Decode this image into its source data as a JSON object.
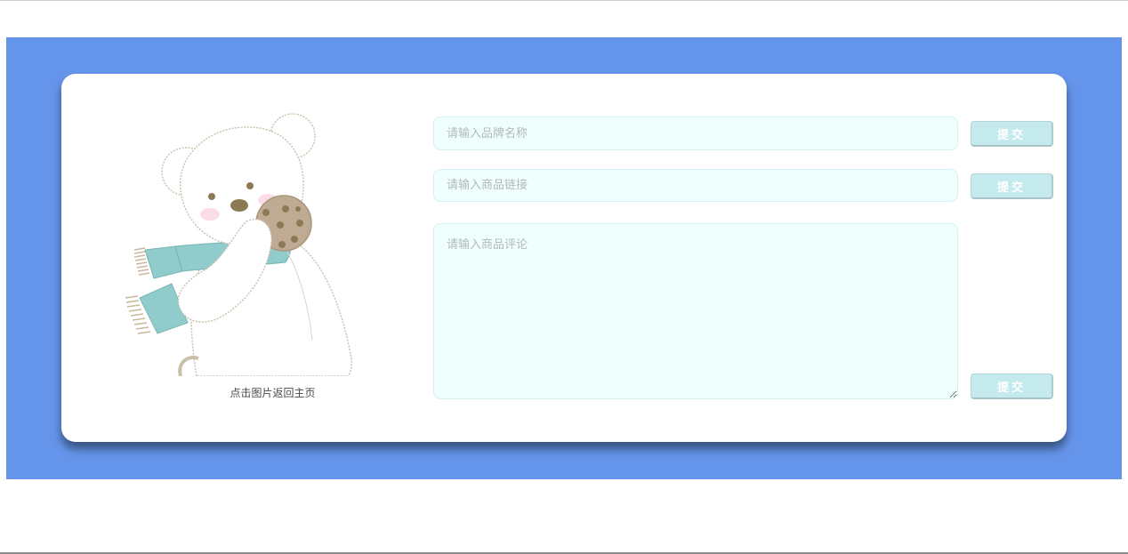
{
  "page": {
    "background_color": "#6595eb",
    "card_color": "#ffffff"
  },
  "hero": {
    "image_name": "polar-bear-cookie-illustration",
    "caption": "点击图片返回主页"
  },
  "form": {
    "brand": {
      "placeholder": "请输入品牌名称",
      "value": ""
    },
    "link": {
      "placeholder": "请输入商品链接",
      "value": ""
    },
    "comment": {
      "placeholder": "请输入商品评论",
      "value": ""
    },
    "submit_label": "提交",
    "input_bg": "#effffe",
    "button_bg": "#c4eaed"
  }
}
